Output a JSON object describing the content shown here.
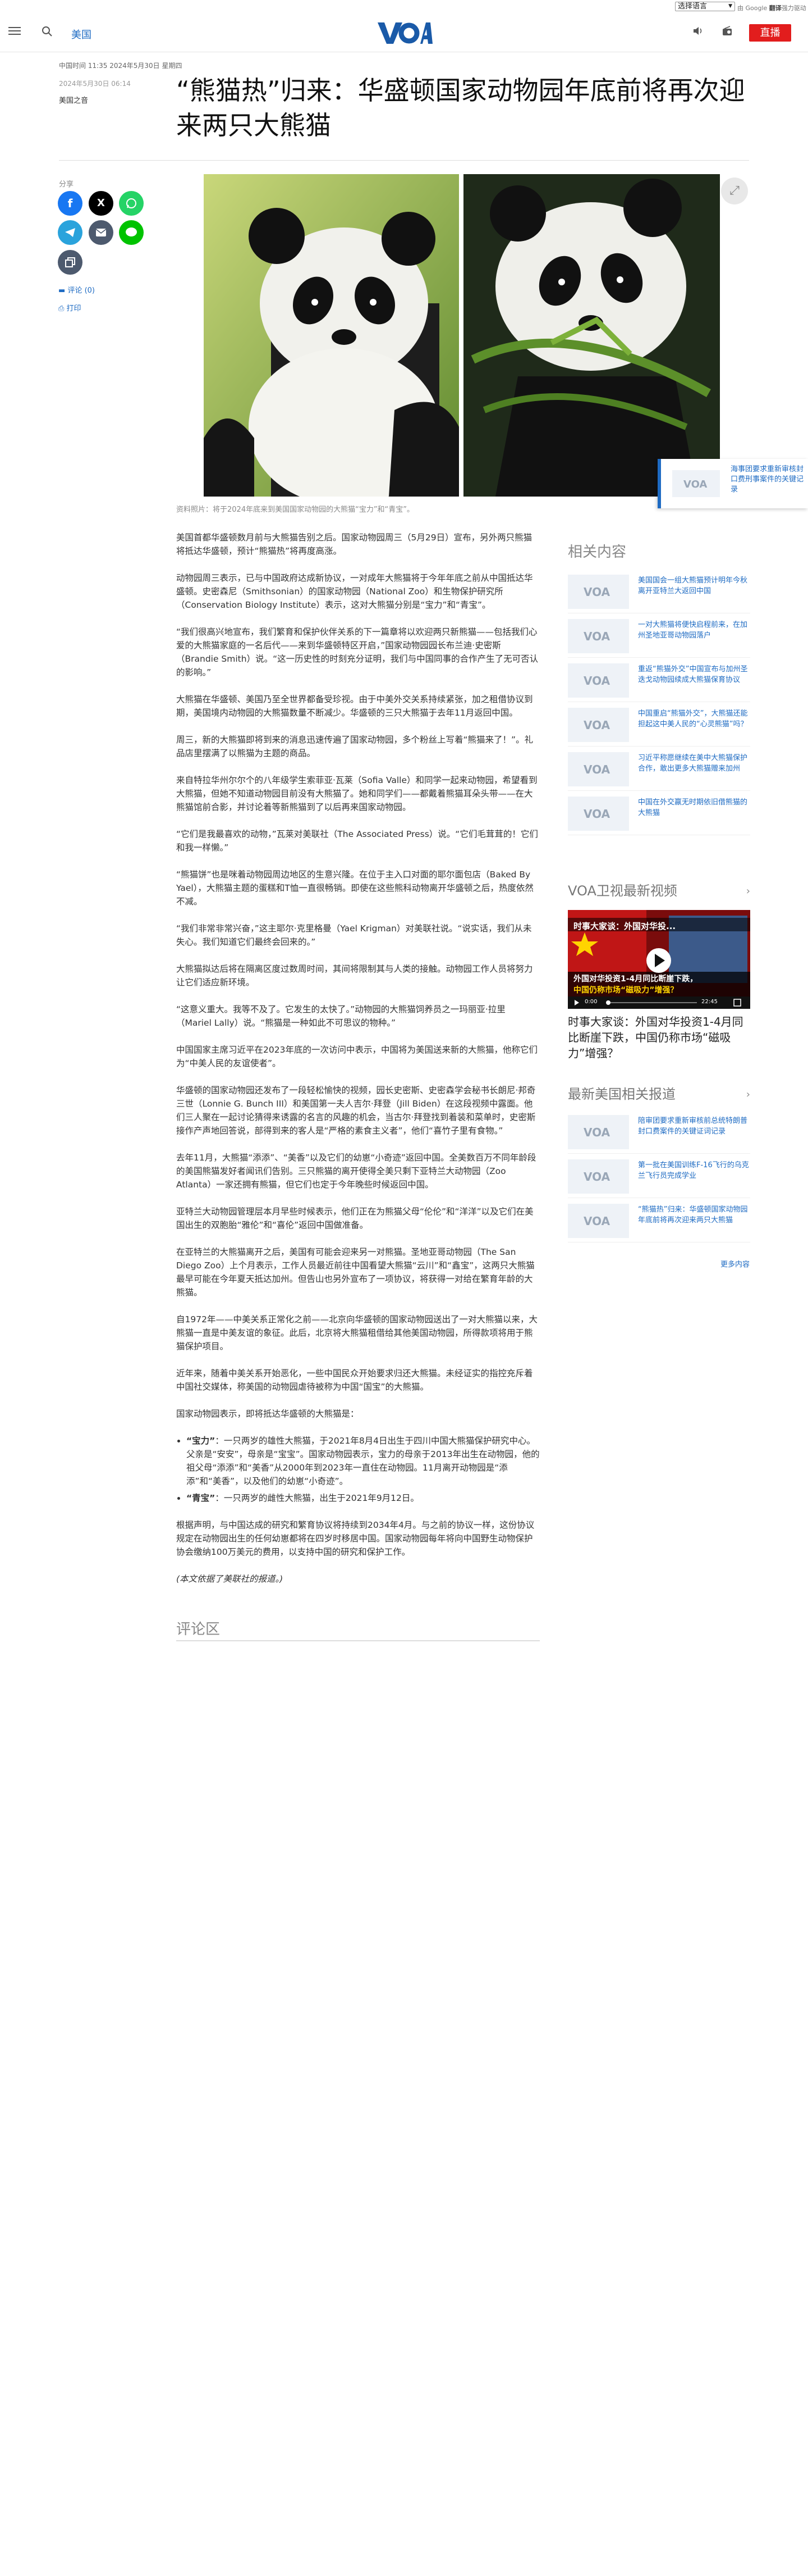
{
  "top": {
    "lang_select": "选择语言",
    "powered_prefix": "由 Google",
    "powered_brand": "翻译",
    "powered_suffix": "强力驱动"
  },
  "header": {
    "section": "美国",
    "logo_text": "VOA",
    "live": "直播"
  },
  "article": {
    "dateline": "中国时间 11:35 2024年5月30日 星期四",
    "pubdate": "2024年5月30日 06:14",
    "byline": "美国之音",
    "title": "“熊猫热”归来：华盛顿国家动物园年底前将再次迎来两只大熊猫",
    "caption": "资料照片：将于2024年底来到美国国家动物园的大熊猫“宝力”和“青宝”。",
    "paragraphs": [
      "美国首都华盛顿数月前与大熊猫告别之后。国家动物园周三（5月29日）宣布，另外两只熊猫将抵达华盛顿，预计“熊猫热”将再度高涨。",
      "动物园周三表示，已与中国政府达成新协议，一对成年大熊猫将于今年年底之前从中国抵达华盛顿。史密森尼（Smithsonian）的国家动物园（National Zoo）和生物保护研究所（Conservation Biology Institute）表示，这对大熊猫分别是“宝力”和“青宝”。",
      "“我们很高兴地宣布，我们繁育和保护伙伴关系的下一篇章将以欢迎两只新熊猫——包括我们心爱的大熊猫家庭的一名后代——来到华盛顿特区开启，”国家动物园园长布兰迪·史密斯（Brandie Smith）说。“这一历史性的时刻充分证明，我们与中国同事的合作产生了无可否认的影响。”",
      "大熊猫在华盛顿、美国乃至全世界都备受珍视。由于中美外交关系持续紧张，加之租借协议到期，美国境内动物园的大熊猫数量不断减少。华盛顿的三只大熊猫于去年11月返回中国。",
      "周三，新的大熊猫即将到来的消息迅速传遍了国家动物园，多个粉丝上写着“熊猫来了！”。礼品店里摆满了以熊猫为主题的商品。",
      "来自特拉华州尔尔个的八年级学生索菲亚·瓦莱（Sofia Valle）和同学一起来动物园，希望看到大熊猫，但她不知道动物园目前没有大熊猫了。她和同学们——都戴着熊猫耳朵头带——在大熊猫馆前合影，并讨论着等新熊猫到了以后再来国家动物园。",
      "“它们是我最喜欢的动物，”瓦莱对美联社（The Associated Press）说。“它们毛茸茸的！它们和我一样懒。”",
      "“熊猫饼”也是咪着动物园周边地区的生意兴隆。在位于主入口对面的耶尔面包店（Baked By Yael），大熊猫主题的蛋糕和T恤一直很畅销。即使在这些熊科动物离开华盛顿之后，热度依然不减。",
      "“我们非常非常兴奋，”这主耶尔·克里格曼（Yael Krigman）对美联社说。“说实话，我们从未失心。我们知道它们最终会回来的。”",
      "大熊猫拟达后将在隔离区度过数周时间，其间将限制其与人类的接触。动物园工作人员将努力让它们适应新环境。",
      "“这意义重大。我等不及了。它发生的太快了。”动物园的大熊猫饲养员之一玛丽亚·拉里（Mariel Lally）说。“熊猫是一种如此不可思议的物种。”",
      "中国国家主席习近平在2023年底的一次访问中表示，中国将为美国送来新的大熊猫，他称它们为“中美人民的友谊使者”。",
      "华盛顿的国家动物园还发布了一段轻松愉快的视频，园长史密斯、史密森学会秘书长朗尼·邦奇三世（Lonnie G. Bunch III）和美国第一夫人吉尔·拜登（Jill Biden）在这段视频中露面。他们三人聚在一起讨论猜得来诱露的名言的风趣的机会，当古尔·拜登找到着装和菜单时，史密斯接作产声地回答说，部得到来的客人是“严格的素食主义者”，他们“喜竹子里有食物。”",
      "去年11月，大熊猫“添添”、“美香”以及它们的幼崽“小奇迹”返回中国。全美数百万不同年龄段的美国熊猫发好者闻讯们告别。三只熊猫的离开使得全美只剩下亚特兰大动物园（Zoo Atlanta）一家还拥有熊猫，但它们也定于今年晚些时候返回中国。",
      "亚特兰大动物园管理层本月早些时候表示，他们正在为熊猫父母“伦伦”和“洋洋”以及它们在美国出生的双胞胎“雅伦”和“喜伦”返回中国做准备。",
      "在亚特兰的大熊猫离开之后，美国有可能会迎来另一对熊猫。圣地亚哥动物园（The San Diego Zoo）上个月表示，工作人员最近前往中国看望大熊猫“云川”和“鑫宝”，这两只大熊猫最早可能在今年夏天抵达加州。但告山也另外宣布了一项协议，将获得一对给在繁育年龄的大熊猫。",
      "自1972年——中美关系正常化之前——北京向华盛顿的国家动物园送出了一对大熊猫以来，大熊猫一直是中美友谊的象征。此后，北京将大熊猫租借给其他美国动物园，所得款项将用于熊猫保护项目。",
      "近年来，随着中美关系开始恶化，一些中国民众开始要求归还大熊猫。未经证实的指控充斥着中国社交媒体，称美国的动物园虐待被称为中国“国宝”的大熊猫。",
      "国家动物园表示，即将抵达华盛顿的大熊猫是："
    ],
    "bullets": [
      {
        "name": "“宝力”",
        "text": "：一只两岁的雄性大熊猫，于2021年8月4日出生于四川中国大熊猫保护研究中心。父亲是“安安”，母亲是“宝宝”。国家动物园表示，宝力的母亲于2013年出生在动物园，他的祖父母“添添”和“美香”从2000年到2023年一直住在动物园。11月离开动物园是“添添”和“美香”，以及他们的幼崽“小奇迹”。"
      },
      {
        "name": "“青宝”",
        "text": "：一只两岁的雌性大熊猫，出生于2021年9月12日。"
      }
    ],
    "closing": "根据声明，与中国达成的研究和繁育协议将持续到2034年4月。与之前的协议一样，这份协议规定在动物园出生的任何幼崽都将在四岁时移居中国。国家动物园每年将向中国野生动物保护协会缴纳100万美元的费用，以支持中国的研究和保护工作。",
    "note": "(本文依据了美联社的报道。)",
    "inline_link": "表示"
  },
  "share": {
    "label": "分享",
    "comments": "评论 (0)",
    "print": "打印"
  },
  "promo": {
    "text": "海事团要求重新审核封口费刑事案件的关键记录"
  },
  "related": {
    "title": "相关内容",
    "items": [
      "美国国会一组大熊猫预计明年今秋离开亚特兰大返回中国",
      "一对大熊猫将便快启程前来，在加州圣地亚哥动物园落户",
      "重返“熊猫外交”中国宣布与加州圣迭戈动物园续成大熊猫保育协议",
      "中国重启“熊猫外交”，大熊猫还能担起这中美人民的“心灵熊猫”吗？",
      "习近平称愿继续在美中大熊猫保护合作，敢出更多大熊猫赠来加州",
      "中国在外交羸无时期依旧借熊猫的大熊猫"
    ]
  },
  "tv": {
    "title": "VOA卫视最新视频",
    "video_title": "时事大家谈：外国对华投资1-4月同比断崖下跌，中国仍称市场“磁吸力”增强？",
    "overlay_top": "时事大家谈：外国对华投...",
    "overlay_line1": "外国对华投资1-4月同比断崖下跌，",
    "overlay_line2": "中国仍称市场“磁吸力”增强？",
    "time_current": "0:00",
    "time_total": "22:45"
  },
  "latest": {
    "title": "最新美国相关报道",
    "items": [
      "陪审团要求重新审核前总统特朗普封口费案件的关键证词记录",
      "第一批在美国训练F-16飞行的乌克兰飞行员完成学业",
      "“熊猫热”归来：华盛顿国家动物园年底前将再次迎来两只大熊猫"
    ],
    "more": "更多内容"
  },
  "comments_section": {
    "title": "评论区"
  },
  "colors": {
    "accent": "#1e6bc3",
    "live": "#e21d1d",
    "brand_blue": "#1a5aa8"
  }
}
